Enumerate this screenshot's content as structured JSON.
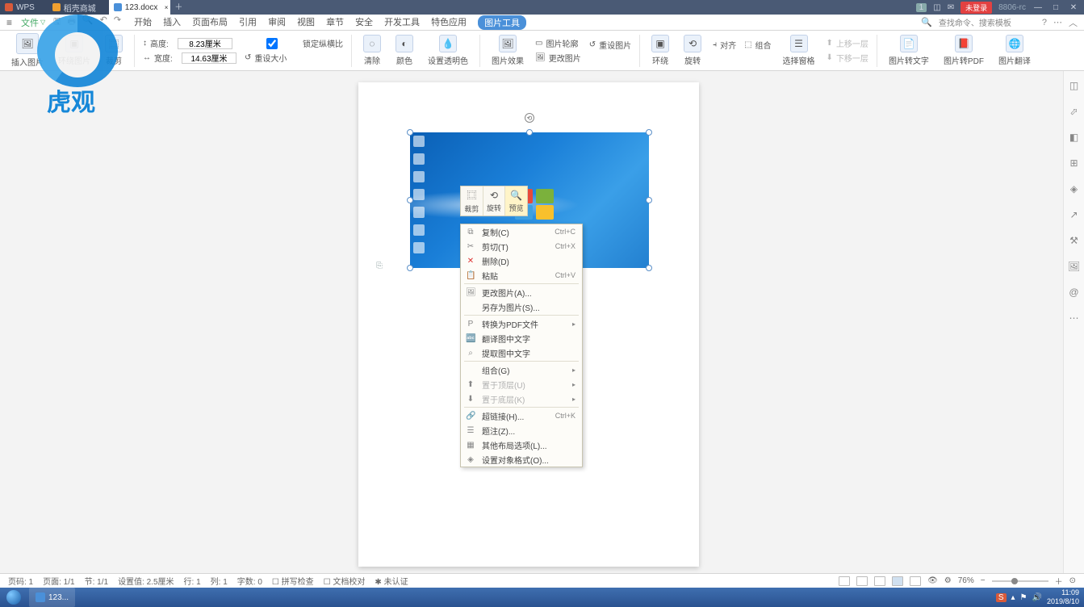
{
  "titlebar": {
    "app": "WPS",
    "tabs": [
      {
        "label": "稻壳商城",
        "color": "#f0a030"
      },
      {
        "label": "123.docx",
        "color": "#4a90d9",
        "active": true
      }
    ],
    "badge": "1",
    "login": "未登录",
    "build": "8806-rc"
  },
  "menubar": {
    "file": "文件",
    "tabs": [
      "开始",
      "插入",
      "页面布局",
      "引用",
      "审阅",
      "视图",
      "章节",
      "安全",
      "开发工具",
      "特色应用",
      "图片工具"
    ],
    "active": "图片工具",
    "search_placeholder": "查找命令、搜索模板"
  },
  "ribbon": {
    "insert_pic": "插入图片",
    "wrap": "环绕图片",
    "crop": "裁剪",
    "height_label": "高度:",
    "height": "8.23厘米",
    "width_label": "宽度:",
    "width": "14.63厘米",
    "lock_ratio": "锁定纵横比",
    "reset_size": "重设大小",
    "clear": "清除",
    "color": "颜色",
    "trans": "设置透明色",
    "effect": "图片效果",
    "outline": "图片轮廓",
    "change": "更改图片",
    "reset_pic": "重设图片",
    "wrap2": "环绕",
    "rotate": "旋转",
    "align": "对齐",
    "group": "组合",
    "select_pane": "选择窗格",
    "up": "上移一层",
    "down": "下移一层",
    "to_text": "图片转文字",
    "to_pdf": "图片转PDF",
    "translate": "图片翻译"
  },
  "minitoolbar": {
    "crop": "裁剪",
    "rotate": "旋转",
    "preview": "预览"
  },
  "context_menu": [
    {
      "icon": "⧉",
      "label": "复制(C)",
      "shortcut": "Ctrl+C"
    },
    {
      "icon": "✂",
      "label": "剪切(T)",
      "shortcut": "Ctrl+X"
    },
    {
      "icon": "✕",
      "label": "删除(D)",
      "red": true
    },
    {
      "icon": "📋",
      "label": "粘贴",
      "shortcut": "Ctrl+V"
    },
    {
      "sep": true
    },
    {
      "icon": "🖼",
      "label": "更改图片(A)..."
    },
    {
      "label": "另存为图片(S)..."
    },
    {
      "sep": true
    },
    {
      "icon": "P",
      "label": "转换为PDF文件",
      "sub": true
    },
    {
      "icon": "🔤",
      "label": "翻译图中文字"
    },
    {
      "icon": "⌕",
      "label": "提取图中文字"
    },
    {
      "sep": true
    },
    {
      "label": "组合(G)",
      "sub": true
    },
    {
      "icon": "⬆",
      "label": "置于顶层(U)",
      "sub": true,
      "disabled": true
    },
    {
      "icon": "⬇",
      "label": "置于底层(K)",
      "sub": true,
      "disabled": true
    },
    {
      "sep": true
    },
    {
      "icon": "🔗",
      "label": "超链接(H)...",
      "shortcut": "Ctrl+K"
    },
    {
      "icon": "☰",
      "label": "题注(Z)..."
    },
    {
      "icon": "▦",
      "label": "其他布局选项(L)..."
    },
    {
      "icon": "◈",
      "label": "设置对象格式(O)..."
    }
  ],
  "statusbar": {
    "page_lbl": "页码: 1",
    "pages": "页面: 1/1",
    "section": "节: 1/1",
    "pos": "设置值: 2.5厘米",
    "line": "行: 1",
    "col": "列: 1",
    "chars": "字数: 0",
    "spell": "拼写检查",
    "proof": "文档校对",
    "cert": "未认证",
    "zoom": "76%"
  },
  "taskbar": {
    "app": "123...",
    "time": "11:09",
    "date": "2019/8/10"
  },
  "watermark": "虎观"
}
